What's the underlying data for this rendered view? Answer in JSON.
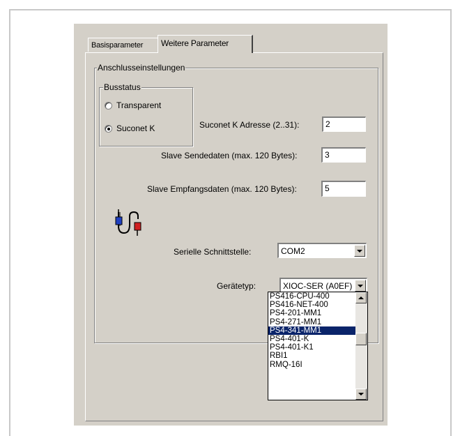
{
  "tabs": [
    {
      "label": "Basisparameter",
      "active": false
    },
    {
      "label": "Weitere Parameter",
      "active": true
    }
  ],
  "anschluss": {
    "group_label": "Anschlusseinstellungen",
    "busstatus": {
      "group_label": "Busstatus",
      "options": [
        {
          "label": "Transparent",
          "selected": false
        },
        {
          "label": "Suconet K",
          "selected": true
        }
      ]
    },
    "adresse": {
      "label": "Suconet K Adresse (2..31):",
      "value": "2"
    },
    "sendedaten": {
      "label": "Slave Sendedaten (max. 120 Bytes):",
      "value": "3"
    },
    "empfangsdaten": {
      "label": "Slave Empfangsdaten (max. 120 Bytes):",
      "value": "5"
    },
    "schnittstelle": {
      "label": "Serielle Schnittstelle:",
      "value": "COM2"
    },
    "geraetetyp": {
      "label": "Gerätetyp:",
      "value": "XIOC-SER (A0EF)",
      "options": [
        "PS416-CPU-400",
        "PS416-NET-400",
        "PS4-201-MM1",
        "PS4-271-MM1",
        "PS4-341-MM1",
        "PS4-401-K",
        "PS4-401-K1",
        "RBI1",
        "RMQ-16I"
      ],
      "highlighted": "PS4-341-MM1"
    }
  },
  "icons": [
    "connection-icon"
  ],
  "colors": {
    "dialog": "#d4d0c8",
    "highlight": "#0a246a",
    "icon_blue": "#2040c0",
    "icon_red": "#d02020"
  }
}
